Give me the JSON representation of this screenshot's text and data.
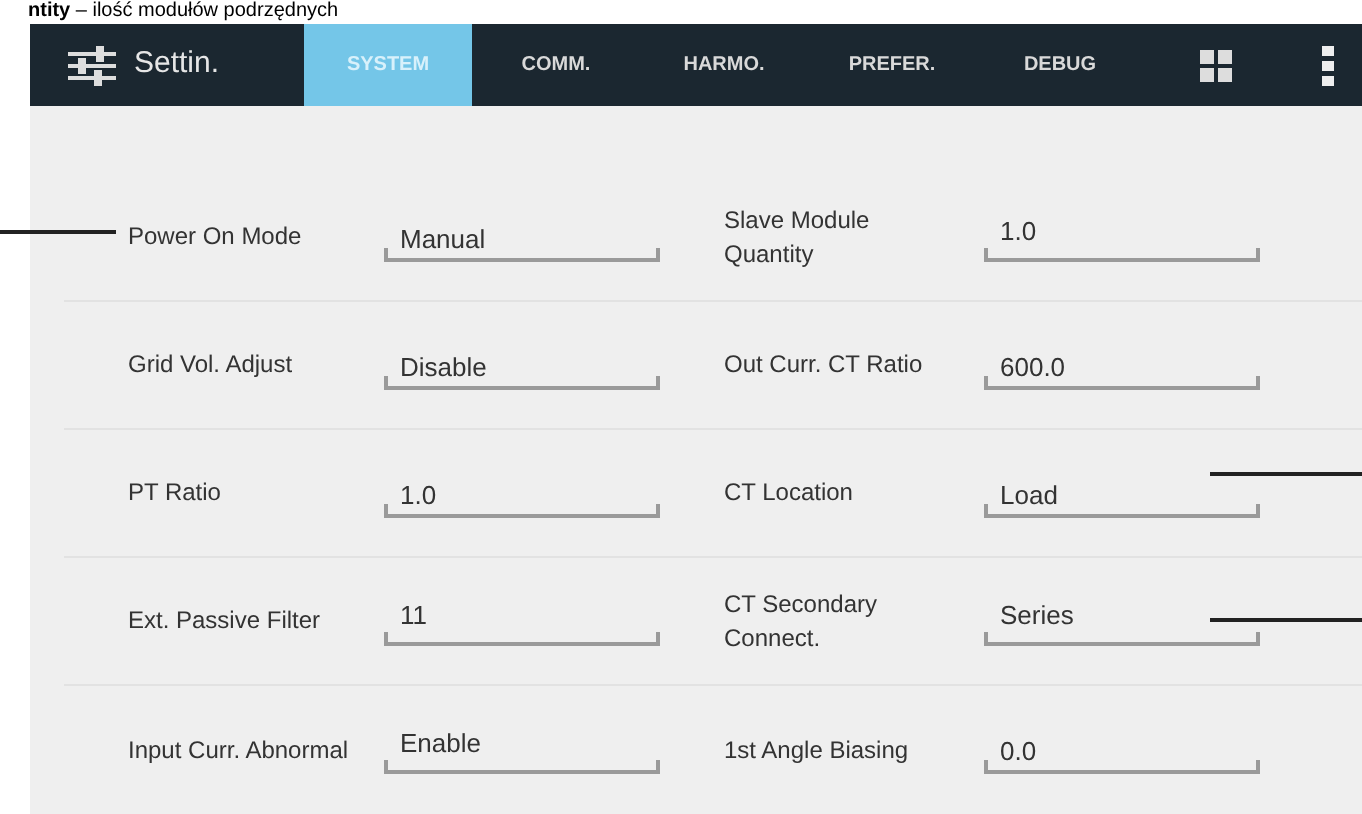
{
  "caption": "**ntity** – ilość modułów podrzędnych",
  "app_bar": {
    "title": "Settin."
  },
  "tabs": [
    {
      "label": "SYSTEM",
      "selected": true
    },
    {
      "label": "COMM.",
      "selected": false
    },
    {
      "label": "HARMO.",
      "selected": false
    },
    {
      "label": "PREFER.",
      "selected": false
    },
    {
      "label": "DEBUG",
      "selected": false
    }
  ],
  "rows": [
    [
      {
        "label": "Power On Mode",
        "value": "Manual"
      },
      {
        "label": "Slave Module Quantity",
        "value": "1.0"
      }
    ],
    [
      {
        "label": "Grid Vol. Adjust",
        "value": "Disable"
      },
      {
        "label": "Out Curr. CT Ratio",
        "value": "600.0"
      }
    ],
    [
      {
        "label": "PT Ratio",
        "value": "1.0"
      },
      {
        "label": "CT Location",
        "value": "Load"
      }
    ],
    [
      {
        "label": "Ext. Passive Filter",
        "value": "11"
      },
      {
        "label": "CT Secondary Connect.",
        "value": "Series"
      }
    ],
    [
      {
        "label": "Input Curr. Abnormal",
        "value": "Enable"
      },
      {
        "label": "1st Angle Biasing",
        "value": "0.0"
      }
    ]
  ]
}
